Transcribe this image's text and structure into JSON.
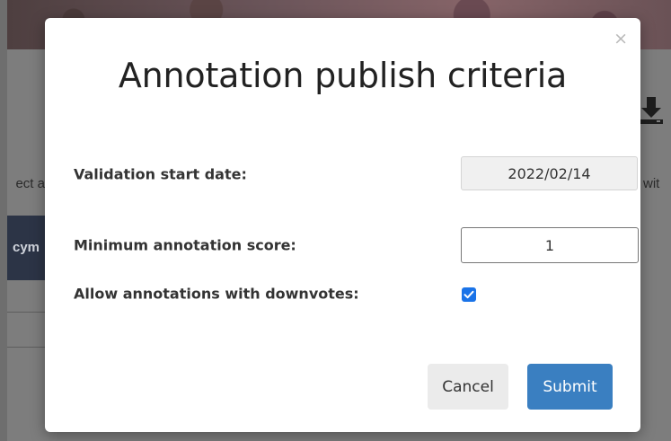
{
  "background": {
    "left_text": "ect a",
    "right_text": "wit",
    "tab_text": "cym",
    "icons": [
      "download-icon"
    ]
  },
  "modal": {
    "title": "Annotation publish criteria",
    "close_symbol": "×",
    "fields": {
      "start_date": {
        "label": "Validation start date:",
        "value": "2022/02/14"
      },
      "min_score": {
        "label": "Minimum annotation score:",
        "value": "1"
      },
      "allow_downvotes": {
        "label": "Allow annotations with downvotes:",
        "checked": true
      }
    },
    "buttons": {
      "cancel": "Cancel",
      "submit": "Submit"
    }
  },
  "colors": {
    "overlay": "#7d7d7d",
    "submit": "#3a7fc1",
    "checkbox": "#1a73e8",
    "cancel": "#ebebeb"
  }
}
